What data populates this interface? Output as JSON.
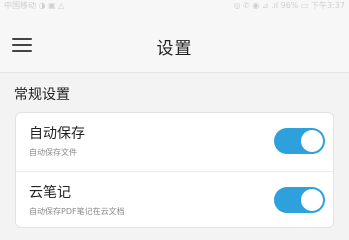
{
  "statusbar": {
    "left": "中国移动 ◑ ▣ △",
    "right": "◎ ✆ ◉ ⊿ .ıl 96% ▭ 下午3:37"
  },
  "header": {
    "title": "设置",
    "menu_icon": "hamburger-menu-icon"
  },
  "section": {
    "title": "常规设置",
    "items": [
      {
        "label": "自动保存",
        "description": "自动保存文件",
        "enabled": true
      },
      {
        "label": "云笔记",
        "description": "自动保存PDF笔记在云文档",
        "enabled": true
      }
    ]
  },
  "colors": {
    "toggle_on": "#2ea1dc",
    "background": "#f3f3f3",
    "card": "#ffffff"
  }
}
